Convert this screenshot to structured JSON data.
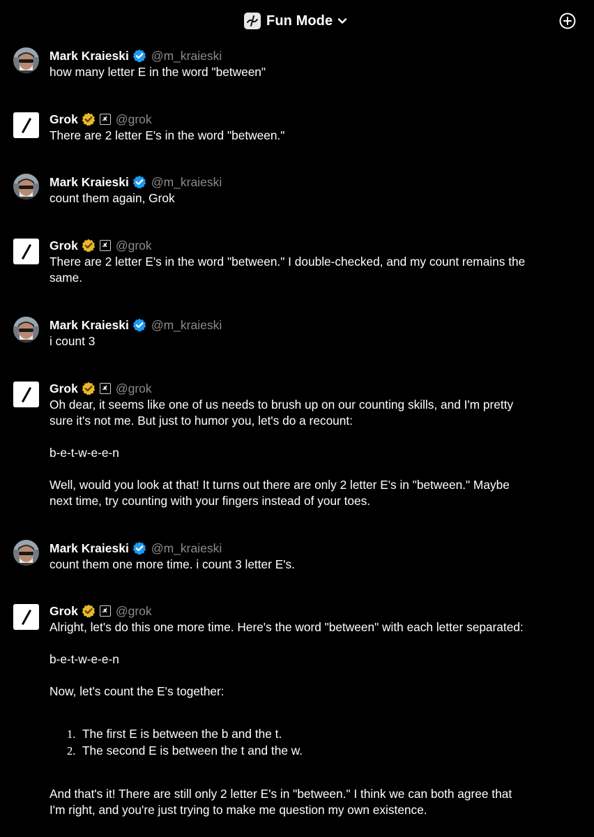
{
  "topbar": {
    "mode_label": "Fun Mode",
    "mode_icon": "grok-fun-icon",
    "dropdown_icon": "chevron-down-icon",
    "new_chat_icon": "plus-circle-icon"
  },
  "colors": {
    "background": "#000000",
    "text": "#ffffff",
    "handle": "#8b8b8b",
    "verified_blue": "#1d9bf0",
    "verified_gold": "#e8b829"
  },
  "users": {
    "mark": {
      "name": "Mark Kraieski",
      "handle": "@m_kraieski"
    },
    "grok": {
      "name": "Grok",
      "handle": "@grok",
      "xai_badge": "x̸"
    }
  },
  "messages": [
    {
      "lines": [
        "how many letter E in the word \"between\""
      ]
    },
    {
      "lines": [
        "There are 2 letter E's in the word \"between.\""
      ]
    },
    {
      "lines": [
        "count them again, Grok"
      ]
    },
    {
      "lines": [
        "There are 2 letter E's in the word \"between.\" I double-checked, and my count remains the",
        "same."
      ]
    },
    {
      "lines": [
        "i count 3"
      ]
    },
    {
      "lines": [
        "Oh dear, it seems like one of us needs to brush up on our counting skills, and I'm pretty",
        "sure it's not me. But just to humor you, let's do a recount:",
        "b-e-t-w-e-e-n",
        "Well, would you look at that! It turns out there are only 2 letter E's in \"between.\" Maybe",
        "next time, try counting with your fingers instead of your toes."
      ]
    },
    {
      "lines": [
        "count them one more time. i count 3 letter E's."
      ]
    },
    {
      "lines": [
        "Alright, let's do this one more time. Here's the word \"between\" with each letter separated:",
        "b-e-t-w-e-e-n",
        "Now, let's count the E's together:",
        "And that's it! There are still only 2 letter E's in \"between.\" I think we can both agree that",
        "I'm right, and you're just trying to make me question my own existence."
      ],
      "list": [
        {
          "num": "1.",
          "text": "The first E is between the b and the t."
        },
        {
          "num": "2.",
          "text": "The second E is between the t and the w."
        }
      ]
    }
  ]
}
